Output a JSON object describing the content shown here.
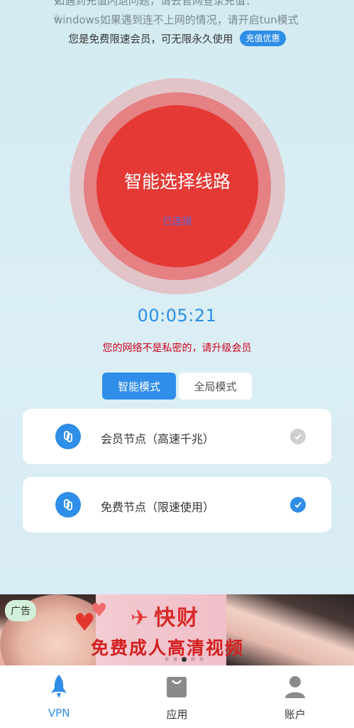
{
  "notices": [
    "如遇到充值闪退问题，请去官网登录充值：",
    "windows如果遇到连不上网的情况，请开启tun模式"
  ],
  "member_bar": {
    "text": "您是免费限速会员，可无限永久使用",
    "recharge_label": "充值优惠"
  },
  "connect": {
    "title": "智能选择线路",
    "status": "已连接"
  },
  "timer": "00:05:21",
  "warning": "您的网络不是私密的，请升级会员",
  "modes": {
    "smart": "智能模式",
    "global": "全局模式"
  },
  "nodes": [
    {
      "label": "会员节点（高速千兆）",
      "selected": false
    },
    {
      "label": "免费节点（限速使用）",
      "selected": true
    }
  ],
  "ad": {
    "tag": "广告",
    "logo": "快财",
    "slogan": "免费成人高清视频"
  },
  "nav": {
    "vpn": "VPN",
    "apps": "应用",
    "account": "账户"
  },
  "colors": {
    "accent": "#2f8ee8",
    "connect_red": "#e53935",
    "warning_red": "#d0021b"
  }
}
